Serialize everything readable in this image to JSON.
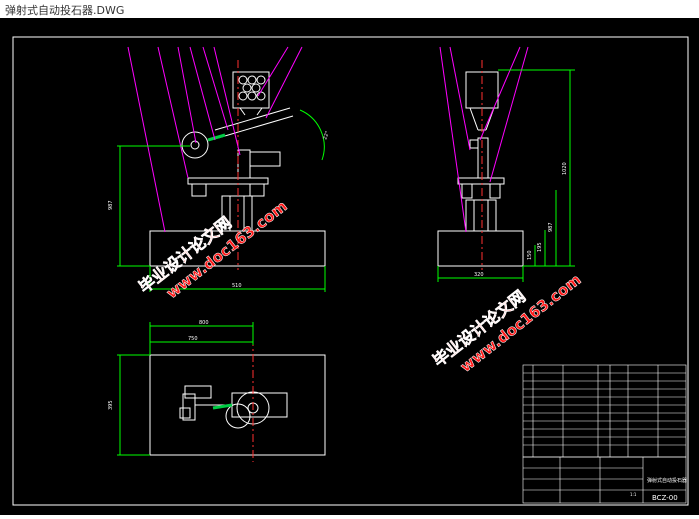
{
  "window": {
    "title": "弹射式自动投石器.DWG"
  },
  "watermarks": [
    {
      "line1": "毕业设计论文网",
      "line2": "www.doc163.com"
    },
    {
      "line1": "毕业设计论文网",
      "line2": "www.doc163.com"
    }
  ],
  "dims": {
    "front_width": "510",
    "front_height": "987",
    "front_angle": "22°",
    "side_width": "320",
    "side_total": "1020",
    "side_mid": "987",
    "side_low": "195",
    "side_small": "150",
    "plan_a": "800",
    "plan_b": "750",
    "plan_h": "395"
  },
  "title_block": {
    "drawing_no": "BCZ-00",
    "name": "弹射式自动投石器",
    "scale": "1:1"
  },
  "colors": {
    "background": "#000000",
    "lines": "#ffffff",
    "leaders": "#ff00ff",
    "centerline": "#ff3030",
    "dimension": "#00ff00",
    "accent": "#00cc44",
    "watermark": "#ff1a1a"
  }
}
